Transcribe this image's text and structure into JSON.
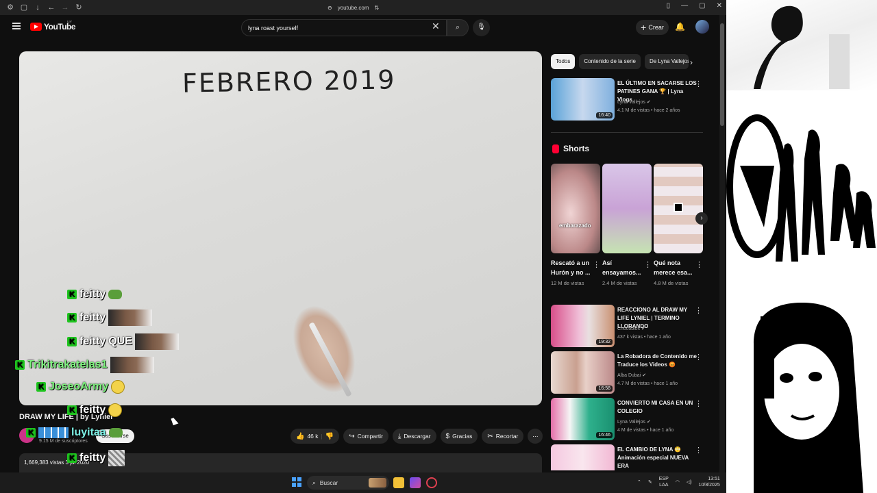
{
  "browser": {
    "url": "youtube.com"
  },
  "header": {
    "logo_text": "YouTube",
    "country": "UY",
    "search_value": "lyna roast yourself",
    "create_label": "Crear"
  },
  "video": {
    "board_text": "FEBRERO 2019",
    "title": "DRAW MY LIFE | by Lyniel",
    "subscribers": "9.15 M de suscriptores",
    "subscribe_label": "Suscribirse",
    "likes": "46 k",
    "share_label": "Compartir",
    "download_label": "Descargar",
    "thanks_label": "Gracias",
    "clip_label": "Recortar",
    "views_date": "1,669,383 vistas  3 jul 2020"
  },
  "chat": [
    {
      "name": "feitty",
      "text": "",
      "emote": "frog",
      "color": "white"
    },
    {
      "name": "feitty",
      "text": "",
      "emote": "face",
      "color": "white"
    },
    {
      "name": "feitty",
      "text": "QUE",
      "emote": "face",
      "color": "white"
    },
    {
      "name": "Trikitrakatelas1",
      "text": "",
      "emote": "face",
      "color": "green"
    },
    {
      "name": "JoseoArmy",
      "text": "",
      "emote": "smiley",
      "color": "green"
    },
    {
      "name": "feitty",
      "text": "",
      "emote": "smiley",
      "color": "white"
    },
    {
      "name": "luyitaa",
      "text": "",
      "emote": "frog",
      "color": "cyan"
    },
    {
      "name": "feitty",
      "text": "",
      "emote": "sq",
      "color": "white"
    },
    {
      "name": "Trikitrakatelas1",
      "text": "",
      "emote": "sq",
      "color": "green"
    }
  ],
  "sidebar": {
    "chips": [
      "Todos",
      "Contenido de la serie",
      "De Lyna Vallejos"
    ],
    "recs": [
      {
        "title": "EL ÚLTIMO EN SACARSE LOS PATINES GANA 🏆 | Lyna Vlogs",
        "channel": "Lyna Vallejos",
        "meta": "4.1 M de vistas • hace 2 años",
        "duration": "16:40"
      },
      {
        "title": "REACCIONO AL DRAW MY LIFE LYNIEL | TERMINO LLORANDO",
        "channel": "Chocoblox",
        "meta": "437 k vistas • hace 1 año",
        "duration": "19:32"
      },
      {
        "title": "La Robadora de Contenido me Traduce los Videos 😡",
        "channel": "Alba Dubai",
        "meta": "4.7 M de vistas • hace 1 año",
        "duration": "16:58"
      },
      {
        "title": "CONVIERTO MI CASA EN UN COLEGIO",
        "channel": "Lyna Vallejos",
        "meta": "4 M de vistas • hace 1 año",
        "duration": "16:46"
      },
      {
        "title": "EL CAMBIO DE LYNA 😳 Animación especial NUEVA ERA",
        "channel": "",
        "meta": "",
        "duration": ""
      }
    ],
    "shorts_label": "Shorts",
    "shorts": [
      {
        "title": "Rescató a un Hurón y no ...",
        "views": "12 M de vistas",
        "overlay": "embarazado"
      },
      {
        "title": "Así ensayamos...",
        "views": "2.4 M de vistas",
        "overlay": ""
      },
      {
        "title": "Qué nota merece esa...",
        "views": "4.8 M de vistas",
        "overlay": ""
      }
    ]
  },
  "taskbar": {
    "search_label": "Buscar",
    "lang_line1": "ESP",
    "lang_line2": "LAA",
    "time": "13:51",
    "date": "10/8/2025"
  }
}
